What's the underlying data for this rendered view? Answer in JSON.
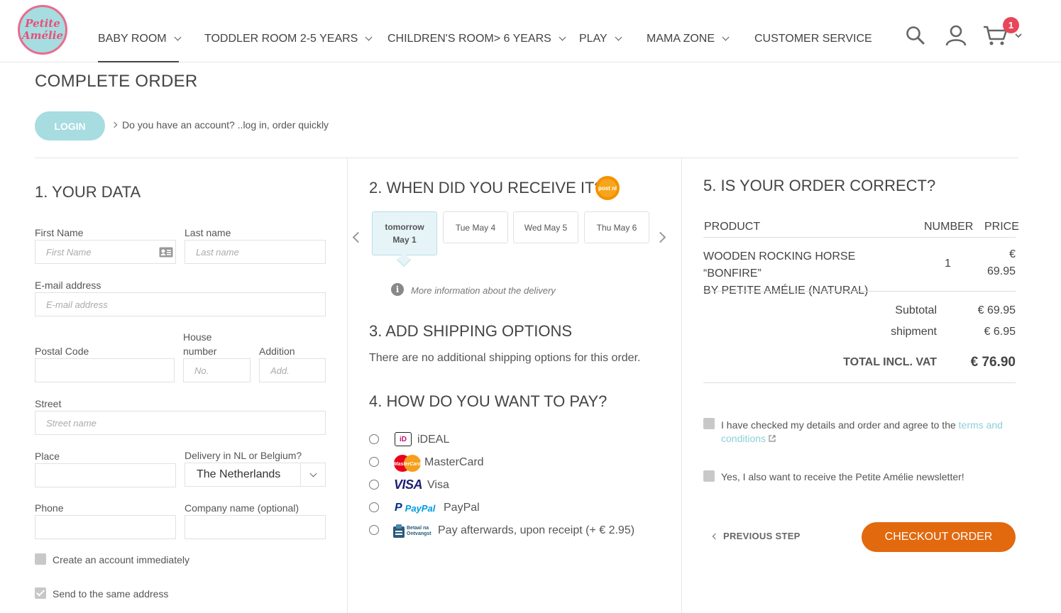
{
  "logo": {
    "line1": "Petite",
    "line2": "Amélie"
  },
  "nav": [
    {
      "label": "BABY ROOM"
    },
    {
      "label": "TODDLER ROOM 2-5 YEARS"
    },
    {
      "label": "CHILDREN'S ROOM> 6 YEARS"
    },
    {
      "label": "PLAY"
    },
    {
      "label": "MAMA ZONE"
    },
    {
      "label": "CUSTOMER SERVICE"
    }
  ],
  "header_icons": {
    "search": "search-icon",
    "account": "user-icon",
    "cart": "cart-icon"
  },
  "cart": {
    "count": "1"
  },
  "page_title": "COMPLETE ORDER",
  "login": {
    "button": "LOGIN",
    "text": "Do you have an account? ..log in, order quickly"
  },
  "your_data": {
    "title": "1. YOUR DATA",
    "first_name_label": "First Name",
    "first_name_placeholder": "First Name",
    "last_name_label": "Last name",
    "last_name_placeholder": "Last name",
    "email_label": "E-mail address",
    "email_placeholder": "E-mail address",
    "postal_code_label": "Postal Code",
    "house_number_label_1": "House",
    "house_number_label_2": "number",
    "house_number_placeholder": "No.",
    "addition_label": "Addition",
    "addition_placeholder": "Add.",
    "street_label": "Street",
    "street_placeholder": "Street name",
    "place_label": "Place",
    "delivery_label": "Delivery in NL or Belgium?",
    "delivery_value": "The Netherlands",
    "phone_label": "Phone",
    "company_label": "Company name (optional)",
    "create_account_label": "Create an account immediately",
    "create_account_checked": false,
    "same_address_label": "Send to the same address",
    "same_address_checked": true
  },
  "delivery": {
    "title": "2. WHEN DID YOU RECEIVE IT?",
    "carrier_logo": "post nl",
    "days": [
      {
        "line1": "tomorrow",
        "line2": "May 1",
        "selected": true
      },
      {
        "line1": "Tue May 4",
        "line2": "",
        "selected": false
      },
      {
        "line1": "Wed May 5",
        "line2": "",
        "selected": false
      },
      {
        "line1": "Thu May 6",
        "line2": "",
        "selected": false
      }
    ],
    "info_text": "More information about the delivery"
  },
  "shipping": {
    "title": "3. ADD SHIPPING OPTIONS",
    "text": "There are no additional shipping options for this order."
  },
  "payment": {
    "title": "4. HOW DO YOU WANT TO PAY?",
    "options": [
      {
        "label": "iDEAL",
        "icon": "ideal-icon",
        "logo_text": "iD"
      },
      {
        "label": "MasterCard",
        "icon": "mastercard-icon",
        "logo_text": "MasterCard"
      },
      {
        "label": "Visa",
        "icon": "visa-icon",
        "logo_text": "VISA"
      },
      {
        "label": "PayPal",
        "icon": "paypal-icon",
        "logo_text": "PayPal"
      },
      {
        "label": "Pay afterwards, upon receipt (+ € 2.95)",
        "icon": "afterpay-icon",
        "logo_text": "Betaal na Ontvangst"
      }
    ]
  },
  "order": {
    "title": "5. IS YOUR ORDER CORRECT?",
    "col_product": "PRODUCT",
    "col_number": "NUMBER",
    "col_price": "PRICE",
    "items": [
      {
        "name_line1": "WOODEN ROCKING HORSE “BONFIRE”",
        "name_line2": "BY PETITE AMÉLIE (NATURAL)",
        "number": "1",
        "price_currency": "€",
        "price_value": "69.95"
      }
    ],
    "subtotal_label": "Subtotal",
    "subtotal_value": "€ 69.95",
    "shipment_label": "shipment",
    "shipment_value": "€ 6.95",
    "total_label": "TOTAL INCL. VAT",
    "total_value": "€ 76.90",
    "terms_text": "I have checked my details and order and agree to the",
    "terms_link": "terms and conditions",
    "newsletter_text": "Yes, I also want to receive the Petite Amélie newsletter!",
    "prev_step": "PREVIOUS STEP",
    "checkout": "CHECKOUT ORDER"
  },
  "colors": {
    "accent": "#a7dce1",
    "checkout": "#e2690e",
    "badge": "#e8465a",
    "link": "#8ccfda"
  }
}
